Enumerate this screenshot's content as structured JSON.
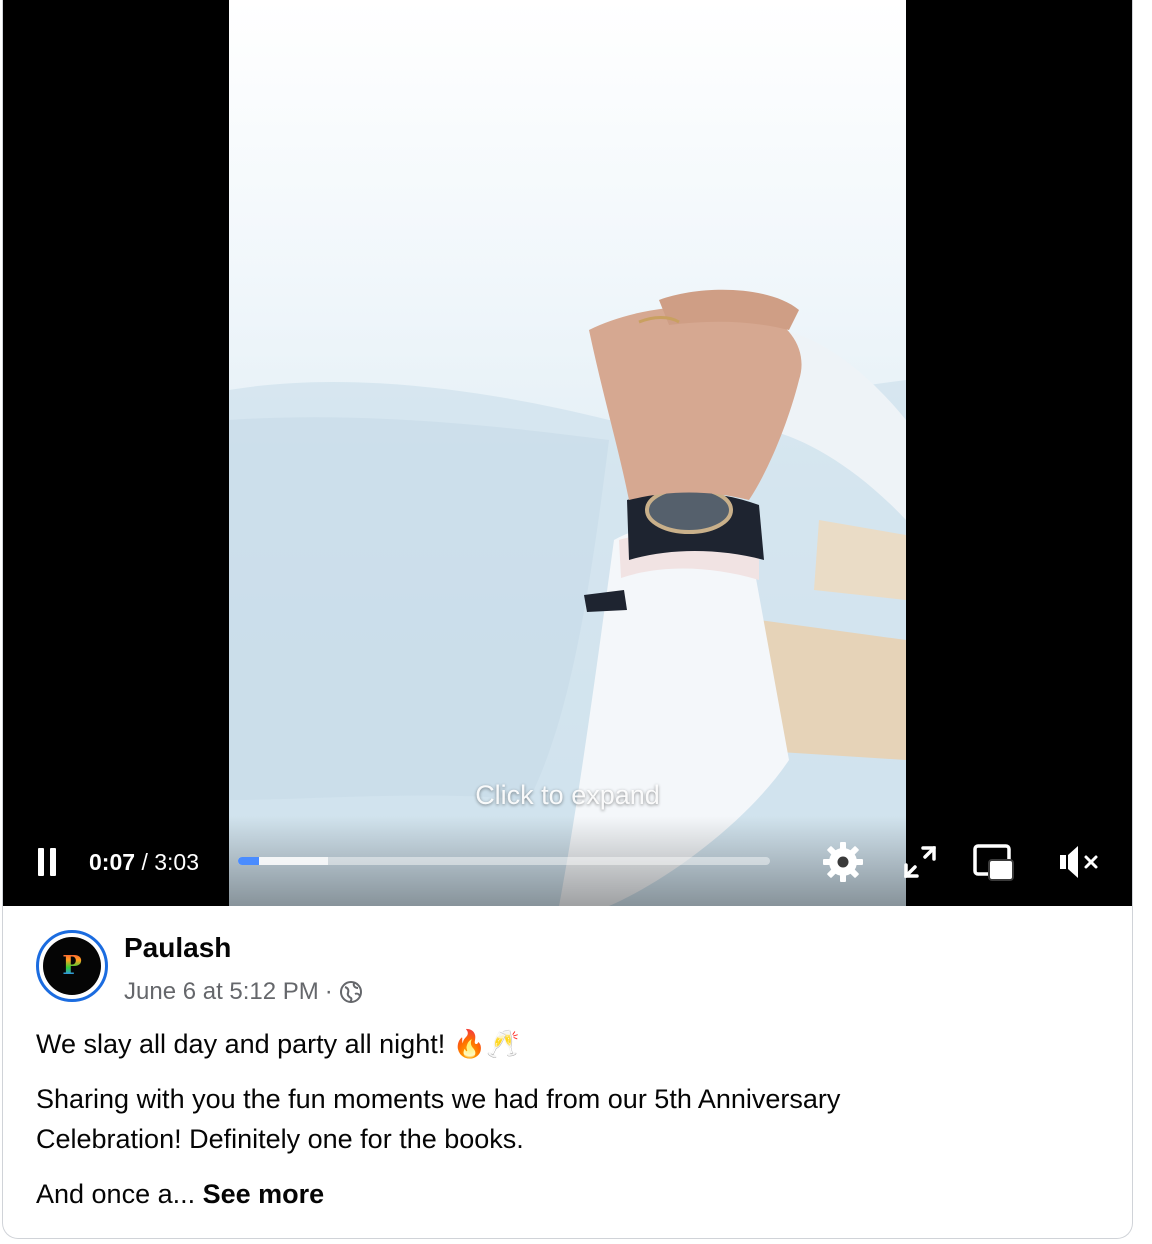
{
  "video": {
    "overlay_hint": "Click to expand",
    "current_time": "0:07",
    "separator": "/",
    "duration": "3:03",
    "played_fraction": 0.04,
    "buffered_fraction": 0.17,
    "icons": [
      "pause-icon",
      "settings-gear-icon",
      "fullscreen-icon",
      "picture-in-picture-icon",
      "muted-speaker-icon"
    ]
  },
  "post": {
    "author": "Paulash",
    "avatar_letter": "P",
    "timestamp": "June 6 at 5:12 PM",
    "meta_separator": "·",
    "audience_icon": "globe-icon",
    "line1": "We slay all day and party all night! 🔥🥂",
    "line2": "Sharing with you the fun moments we had from our 5th Anniversary",
    "line3": "Celebration! Definitely one for the books.",
    "line4_prefix": "And once a... ",
    "see_more": "See more"
  },
  "colors": {
    "accent_blue": "#1b6ce0",
    "progress_played": "#4a8cff",
    "meta_gray": "#65676b"
  }
}
